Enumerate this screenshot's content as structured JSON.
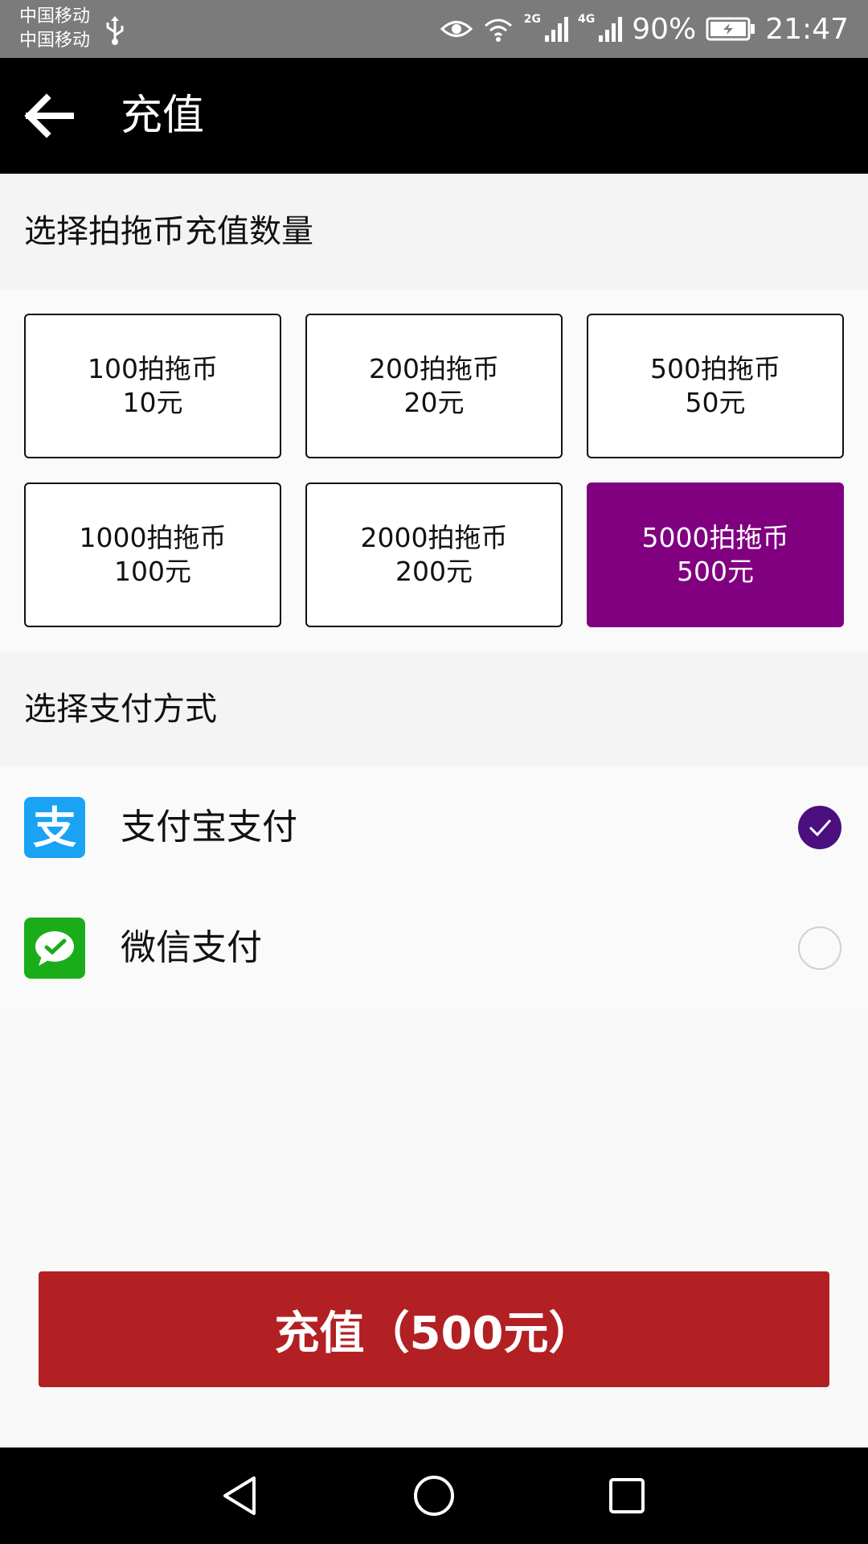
{
  "status_bar": {
    "carrier_1": "中国移动",
    "carrier_2": "中国移动",
    "network_1": "2G",
    "network_2": "4G",
    "battery": "90%",
    "time": "21:47",
    "icons": [
      "usb-icon",
      "eye-icon",
      "wifi-icon",
      "signal-icon",
      "battery-icon"
    ]
  },
  "header": {
    "title": "充值",
    "back_icon": "arrow-left-icon"
  },
  "amount_section": {
    "heading": "选择拍拖币充值数量",
    "options": [
      {
        "coins": "100拍拖币",
        "price": "10元"
      },
      {
        "coins": "200拍拖币",
        "price": "20元"
      },
      {
        "coins": "500拍拖币",
        "price": "50元"
      },
      {
        "coins": "1000拍拖币",
        "price": "100元"
      },
      {
        "coins": "2000拍拖币",
        "price": "200元"
      },
      {
        "coins": "5000拍拖币",
        "price": "500元"
      }
    ],
    "selected_index": 5
  },
  "payment_section": {
    "heading": "选择支付方式",
    "methods": [
      {
        "label": "支付宝支付",
        "icon": "alipay-icon",
        "checked": true
      },
      {
        "label": "微信支付",
        "icon": "wechat-icon",
        "checked": false
      }
    ]
  },
  "submit": {
    "label": "充值（500元）"
  },
  "colors": {
    "selected_option": "#800080",
    "radio_checked": "#4b0f80",
    "submit_button": "#b22023",
    "alipay": "#1aa2f5",
    "wechat": "#1aad19"
  },
  "nav_bar": {
    "icons": [
      "nav-back-icon",
      "nav-home-icon",
      "nav-recent-icon"
    ]
  }
}
